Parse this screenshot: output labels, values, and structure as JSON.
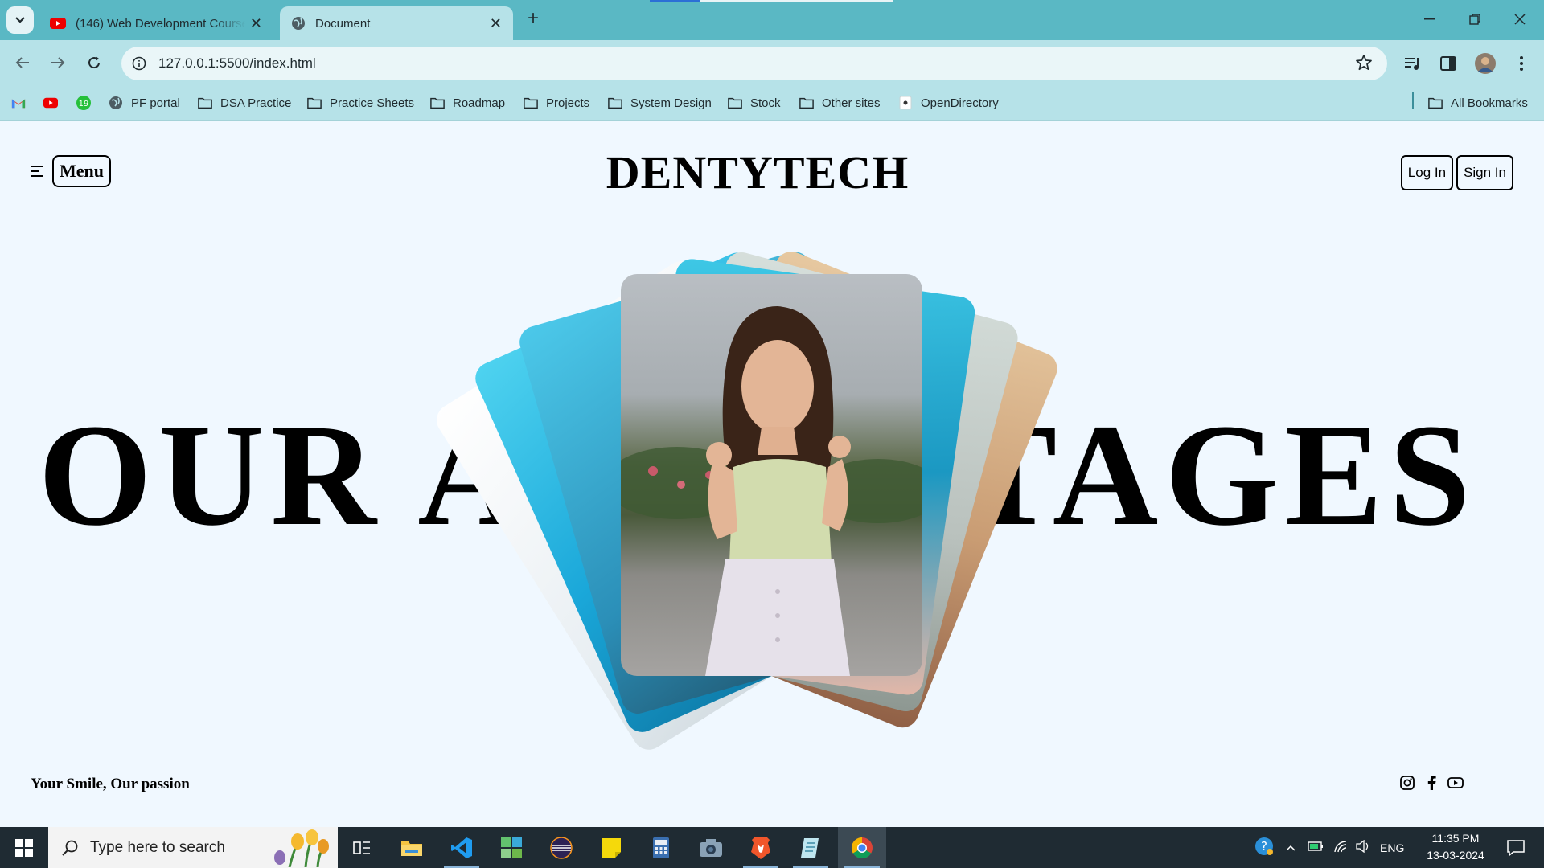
{
  "browser": {
    "tabs": [
      {
        "title": "(146) Web Development Course",
        "active": false,
        "favicon": "youtube-icon"
      },
      {
        "title": "Document",
        "active": true,
        "favicon": "globe-icon"
      }
    ],
    "url": "127.0.0.1:5500/index.html",
    "bookmarks": [
      {
        "label": "",
        "icon": "gmail-icon"
      },
      {
        "label": "",
        "icon": "youtube-icon"
      },
      {
        "label": "",
        "icon": "notification-icon"
      },
      {
        "label": "PF portal",
        "icon": "globe-icon"
      },
      {
        "label": "DSA Practice",
        "icon": "folder-icon"
      },
      {
        "label": "Practice Sheets",
        "icon": "folder-icon"
      },
      {
        "label": "Roadmap",
        "icon": "folder-icon"
      },
      {
        "label": "Projects",
        "icon": "folder-icon"
      },
      {
        "label": "System Design",
        "icon": "folder-icon"
      },
      {
        "label": "Stock",
        "icon": "folder-icon"
      },
      {
        "label": "Other sites",
        "icon": "folder-icon"
      },
      {
        "label": "OpenDirectory",
        "icon": "page-icon"
      }
    ],
    "all_bookmarks": "All Bookmarks"
  },
  "page": {
    "menu_label": "Menu",
    "brand": "DENTYTECH",
    "login_label": "Log In",
    "signin_label": "Sign In",
    "headline": "OUR ADVANTAGES",
    "tagline": "Your Smile, Our passion",
    "social": [
      "instagram-icon",
      "facebook-icon",
      "youtube-icon"
    ]
  },
  "taskbar": {
    "search_placeholder": "Type here to search",
    "time": "11:35 PM",
    "date": "13-03-2024",
    "language": "ENG"
  },
  "colors": {
    "tab_strip": "#5ab8c4",
    "toolbar": "#b6e2e8",
    "page_bg": "#f0f8ff",
    "taskbar": "#1f2b33"
  }
}
